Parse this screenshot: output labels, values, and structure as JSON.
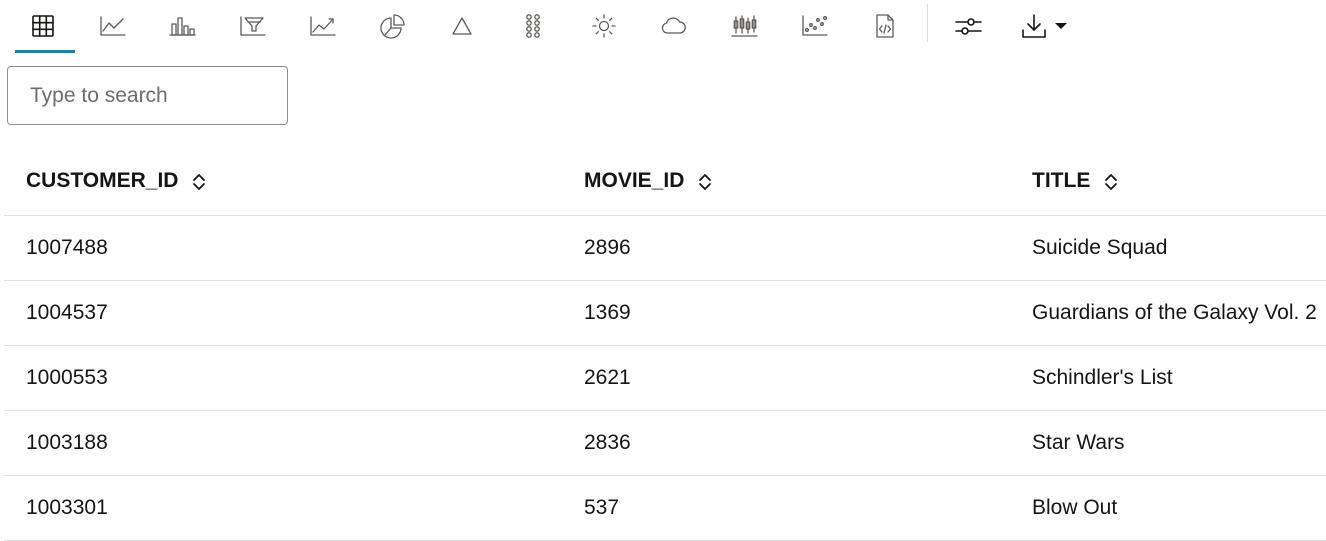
{
  "toolbar": {
    "buttons": [
      {
        "icon": "table-icon",
        "active": true
      },
      {
        "icon": "line-chart-icon"
      },
      {
        "icon": "bar-chart-icon"
      },
      {
        "icon": "funnel-chart-icon"
      },
      {
        "icon": "area-chart-icon"
      },
      {
        "icon": "pie-chart-icon"
      },
      {
        "icon": "pyramid-icon"
      },
      {
        "icon": "dots-grid-icon"
      },
      {
        "icon": "sun-burst-icon"
      },
      {
        "icon": "cloud-icon"
      },
      {
        "icon": "box-plot-icon"
      },
      {
        "icon": "scatter-plot-icon"
      },
      {
        "icon": "code-file-icon"
      },
      {
        "icon": "settings-sliders-icon"
      },
      {
        "icon": "download-icon"
      }
    ],
    "accent_color": "#227e9e"
  },
  "search": {
    "placeholder": "Type to search",
    "value": ""
  },
  "table": {
    "columns": [
      "CUSTOMER_ID",
      "MOVIE_ID",
      "TITLE"
    ],
    "rows": [
      [
        "1007488",
        "2896",
        "Suicide Squad"
      ],
      [
        "1004537",
        "1369",
        "Guardians of the Galaxy Vol. 2"
      ],
      [
        "1000553",
        "2621",
        "Schindler's List"
      ],
      [
        "1003188",
        "2836",
        "Star Wars"
      ],
      [
        "1003301",
        "537",
        "Blow Out"
      ]
    ]
  }
}
